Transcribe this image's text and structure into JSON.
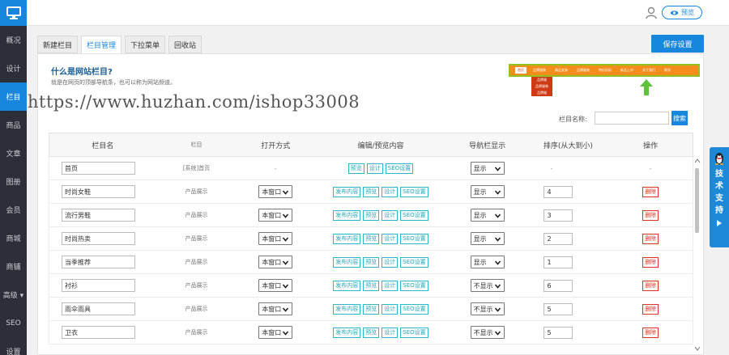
{
  "sidebar": {
    "items": [
      {
        "label": "概况"
      },
      {
        "label": "设计"
      },
      {
        "label": "栏目",
        "active": true
      },
      {
        "label": "商品"
      },
      {
        "label": "文章"
      },
      {
        "label": "图册"
      },
      {
        "label": "会员"
      },
      {
        "label": "商城"
      },
      {
        "label": "商铺"
      },
      {
        "label": "高级 ▾"
      },
      {
        "label": "SEO"
      },
      {
        "label": "设置"
      }
    ]
  },
  "topbar": {
    "preview_label": "预览"
  },
  "tabs": [
    {
      "label": "新建栏目"
    },
    {
      "label": "栏目管理",
      "active": true
    },
    {
      "label": "下拉菜单"
    },
    {
      "label": "回收站"
    }
  ],
  "save_label": "保存设置",
  "help": {
    "title": "什么是网站栏目?",
    "text": "就是在网页的顶部导航条，也可以称为网站频道。"
  },
  "nav_demo": {
    "items": [
      "首页",
      "品牌服装",
      "精品女装",
      "品牌服装",
      "特价折扣",
      "新品上市",
      "关于我们",
      "联系"
    ],
    "sub_items": [
      "品牌服",
      "品牌服装",
      "品牌服"
    ]
  },
  "watermark": "https://www.huzhan.com/ishop33008",
  "search": {
    "label": "栏目名称:",
    "value": "",
    "button": "搜索"
  },
  "table": {
    "headers": [
      "栏目名",
      "栏目",
      "打开方式",
      "编辑/预览内容",
      "导航栏显示",
      "排序(从大到小)",
      "操作"
    ],
    "rows": [
      {
        "name": "首页",
        "type": "[系统]首页",
        "open": "-",
        "actions": [
          "预览",
          "设计",
          "SEO设置"
        ],
        "nav": "显示",
        "order": "-",
        "op": "-"
      },
      {
        "name": "时尚女鞋",
        "type": "产品展示",
        "open": "本窗口",
        "actions": [
          "发布内容",
          "预览",
          "设计",
          "SEO设置"
        ],
        "nav": "显示",
        "order": "4",
        "op": "删除"
      },
      {
        "name": "流行男鞋",
        "type": "产品展示",
        "open": "本窗口",
        "actions": [
          "发布内容",
          "预览",
          "设计",
          "SEO设置"
        ],
        "nav": "显示",
        "order": "3",
        "op": "删除"
      },
      {
        "name": "时尚热卖",
        "type": "产品展示",
        "open": "本窗口",
        "actions": [
          "发布内容",
          "预览",
          "设计",
          "SEO设置"
        ],
        "nav": "显示",
        "order": "2",
        "op": "删除"
      },
      {
        "name": "当季推荐",
        "type": "产品展示",
        "open": "本窗口",
        "actions": [
          "发布内容",
          "预览",
          "设计",
          "SEO设置"
        ],
        "nav": "显示",
        "order": "1",
        "op": "删除"
      },
      {
        "name": "衬衫",
        "type": "产品展示",
        "open": "本窗口",
        "actions": [
          "发布内容",
          "预览",
          "设计",
          "SEO设置"
        ],
        "nav": "不显示",
        "order": "6",
        "op": "删除"
      },
      {
        "name": "雨伞雨具",
        "type": "产品展示",
        "open": "本窗口",
        "actions": [
          "发布内容",
          "预览",
          "设计",
          "SEO设置"
        ],
        "nav": "不显示",
        "order": "5",
        "op": "删除"
      },
      {
        "name": "卫衣",
        "type": "产品展示",
        "open": "本窗口",
        "actions": [
          "发布内容",
          "预览",
          "设计",
          "SEO设置"
        ],
        "nav": "不显示",
        "order": "5",
        "op": "删除"
      }
    ]
  },
  "support": {
    "label": "技术支持"
  },
  "colors": {
    "accent": "#1787dd",
    "sidebar": "#2c2f38",
    "action": "#21a7ba",
    "danger": "#d9342a",
    "nav_demo": "#f58d1c"
  }
}
